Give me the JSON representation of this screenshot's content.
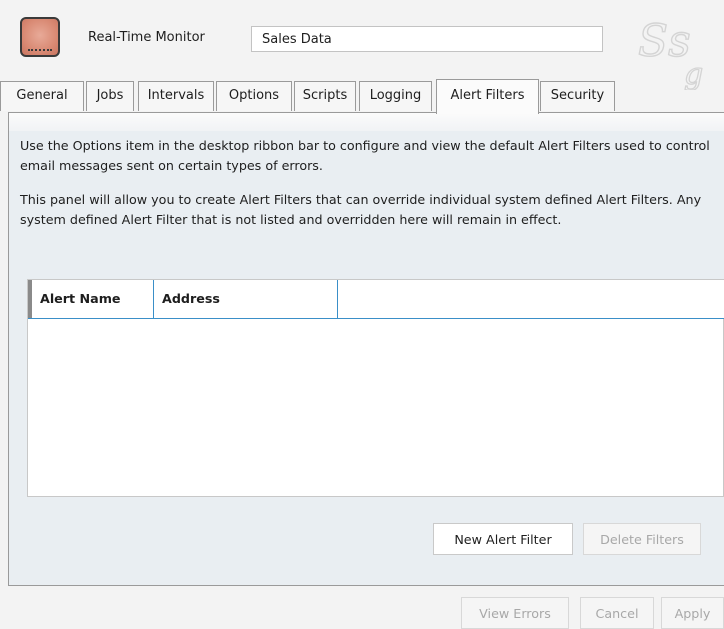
{
  "header": {
    "icon": "monitor-icon",
    "label": "Real-Time Monitor",
    "name_value": "Sales Data",
    "logo_text": "Ssg"
  },
  "tabs": [
    {
      "label": "General",
      "active": false
    },
    {
      "label": "Jobs",
      "active": false
    },
    {
      "label": "Intervals",
      "active": false
    },
    {
      "label": "Options",
      "active": false
    },
    {
      "label": "Scripts",
      "active": false
    },
    {
      "label": "Logging",
      "active": false
    },
    {
      "label": "Alert Filters",
      "active": true
    },
    {
      "label": "Security",
      "active": false
    }
  ],
  "panel": {
    "para1": "Use the Options item in the desktop ribbon bar to configure and view the default Alert Filters used to control email messages sent on certain types of errors.",
    "para2": "This panel will allow you to create Alert Filters that can override individual system defined Alert Filters. Any system defined Alert Filter that is not listed and overridden here will remain in effect.",
    "grid": {
      "columns": [
        "Alert Name",
        "Address",
        ""
      ],
      "rows": []
    },
    "new_button": "New Alert Filter",
    "delete_button": "Delete Filters"
  },
  "footer": {
    "view_errors": "View Errors",
    "cancel": "Cancel",
    "apply": "Apply"
  },
  "colors": {
    "accent": "#3a8fc8",
    "panel_bg": "#e9eef2",
    "window_bg": "#f3f3f3"
  }
}
